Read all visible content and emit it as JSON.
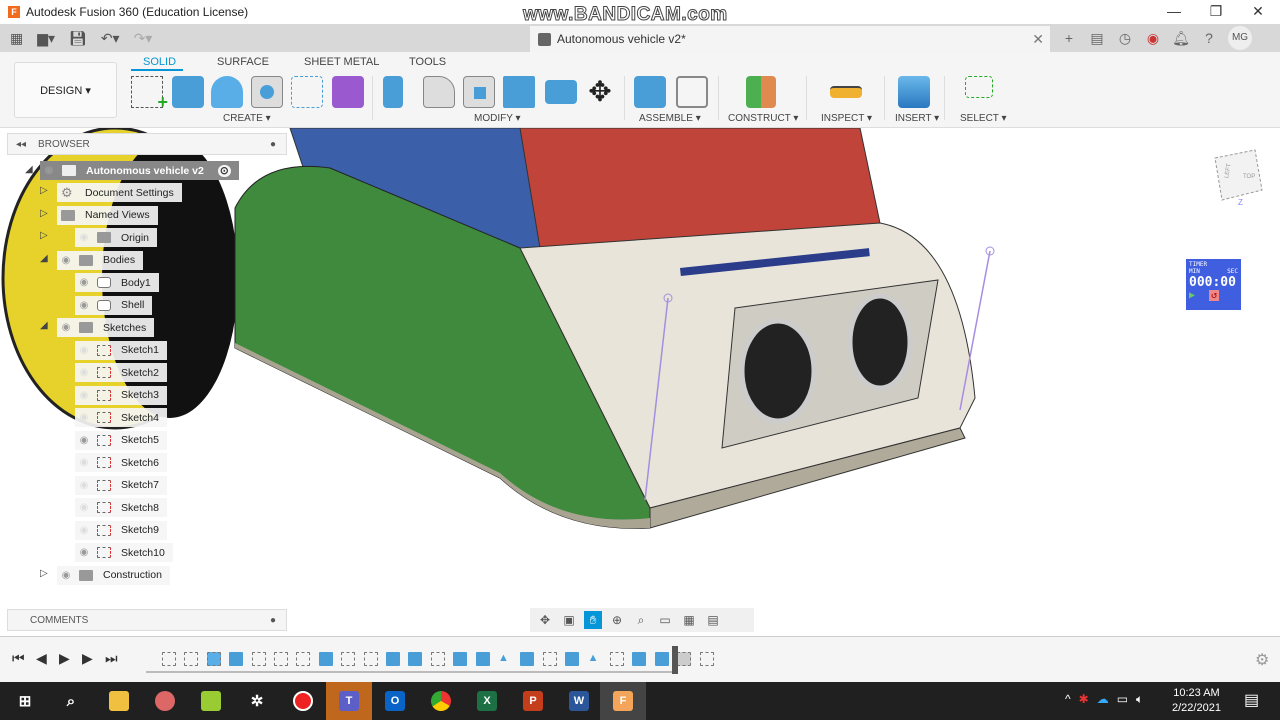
{
  "window": {
    "title": "Autodesk Fusion 360 (Education License)",
    "logo": "F",
    "minimize": "—",
    "maximize": "❐",
    "close": "✕"
  },
  "watermark": "www.BANDICAM.com",
  "document_tab": {
    "title": "Autonomous vehicle v2*",
    "close": "✕"
  },
  "user_initials": "MG",
  "workspace": "DESIGN ▾",
  "ribbon_tabs": [
    {
      "label": "SOLID",
      "active": true
    },
    {
      "label": "SURFACE"
    },
    {
      "label": "SHEET METAL"
    },
    {
      "label": "TOOLS"
    }
  ],
  "groups": {
    "create": "CREATE ▾",
    "modify": "MODIFY ▾",
    "assemble": "ASSEMBLE ▾",
    "construct": "CONSTRUCT ▾",
    "inspect": "INSPECT ▾",
    "insert": "INSERT ▾",
    "select": "SELECT ▾"
  },
  "browser": {
    "title": "BROWSER",
    "root": "Autonomous vehicle v2",
    "items": [
      {
        "label": "Document Settings"
      },
      {
        "label": "Named Views"
      },
      {
        "label": "Origin",
        "visible": false
      },
      {
        "label": "Bodies",
        "visible": true
      },
      {
        "label": "Body1",
        "visible": true
      },
      {
        "label": "Shell",
        "visible": true
      },
      {
        "label": "Sketches",
        "visible": true
      },
      {
        "label": "Sketch1",
        "visible": false
      },
      {
        "label": "Sketch2",
        "visible": false
      },
      {
        "label": "Sketch3",
        "visible": false
      },
      {
        "label": "Sketch4",
        "visible": false
      },
      {
        "label": "Sketch5",
        "visible": true
      },
      {
        "label": "Sketch6",
        "visible": false
      },
      {
        "label": "Sketch7",
        "visible": false
      },
      {
        "label": "Sketch8",
        "visible": false
      },
      {
        "label": "Sketch9",
        "visible": false
      },
      {
        "label": "Sketch10",
        "visible": true
      },
      {
        "label": "Construction",
        "visible": true
      }
    ]
  },
  "comments": {
    "title": "COMMENTS"
  },
  "viewcube": {
    "left": "LEFT",
    "top": "TOP",
    "axis": "Z"
  },
  "timer": {
    "label": "TIMER",
    "min": "MIN",
    "sec": "SEC",
    "value": "000:00"
  },
  "taskbar": {
    "time": "10:23 AM",
    "date": "2/22/2021"
  },
  "colors": {
    "accent": "#0696d7",
    "shell_green": "#3f8a3c",
    "shell_red": "#c0443a",
    "body_cream": "#e8e4da"
  }
}
